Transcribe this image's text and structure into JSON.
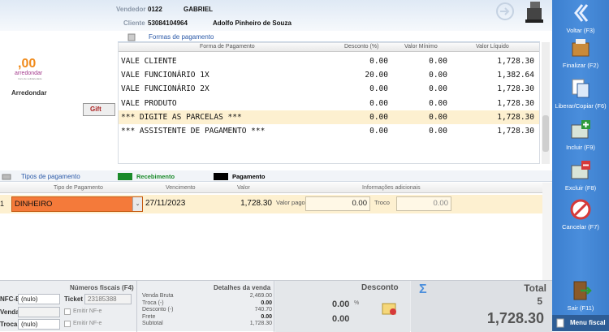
{
  "header": {
    "vendedor_label": "Vendedor",
    "vendedor_code": "0122",
    "vendedor_name": "GABRIEL",
    "cliente_label": "Cliente",
    "cliente_code": "53084104964",
    "cliente_name": "Adolfo Pinheiro de Souza"
  },
  "left": {
    "logo_text": ",00",
    "logo_sub": "arredondar",
    "logo_tiny": "troco de solidariedade",
    "arredondar_label": "Arredondar",
    "gift_label": "Gift"
  },
  "formas": {
    "title": "Formas de pagamento",
    "columns": [
      "Forma de Pagamento",
      "Desconto (%)",
      "Valor Mínimo",
      "Valor Líquido"
    ],
    "rows": [
      {
        "forma": "VALE CLIENTE",
        "desconto": "0.00",
        "minimo": "0.00",
        "liquido": "1,728.30"
      },
      {
        "forma": "VALE FUNCIONÁRIO 1X",
        "desconto": "20.00",
        "minimo": "0.00",
        "liquido": "1,382.64"
      },
      {
        "forma": "VALE FUNCIONÁRIO 2X",
        "desconto": "0.00",
        "minimo": "0.00",
        "liquido": "1,728.30"
      },
      {
        "forma": "VALE PRODUTO",
        "desconto": "0.00",
        "minimo": "0.00",
        "liquido": "1,728.30"
      },
      {
        "forma": "*** DIGITE AS PARCELAS ***",
        "desconto": "0.00",
        "minimo": "0.00",
        "liquido": "1,728.30"
      },
      {
        "forma": "*** ASSISTENTE DE PAGAMENTO ***",
        "desconto": "0.00",
        "minimo": "0.00",
        "liquido": "1,728.30"
      }
    ]
  },
  "tipos": {
    "title": "Tipos de pagamento",
    "recebimento": "Recebimento",
    "pagamento": "Pagamento",
    "colors": {
      "recebimento": "#1a8a2a",
      "pagamento": "#000000"
    }
  },
  "detail": {
    "columns": [
      "Tipo de Pagamento",
      "Vencimento",
      "Valor",
      "Informações adicionais"
    ],
    "row": {
      "index": "1",
      "tipo": "DINHEIRO",
      "vencimento": "27/11/2023",
      "valor": "1,728.30",
      "valor_pago_label": "Valor pago",
      "valor_pago": "0.00",
      "troco_label": "Troco",
      "troco": "0.00"
    }
  },
  "fiscal": {
    "title": "Números fiscais (F4)",
    "nfce_label": "NFC-E",
    "nfce_value": "(nulo)",
    "ticket_label": "Ticket",
    "ticket_value": "23185388",
    "venda_label": "Venda",
    "emitir1": "Emitir NF-e",
    "troca_label": "Troca",
    "troca_value": "(nulo)",
    "emitir2": "Emitir NF-e"
  },
  "detalhes": {
    "title": "Detalhes da venda",
    "rows": [
      {
        "label": "Venda Bruta",
        "value": "2,469.00"
      },
      {
        "label": "Troca (-)",
        "value": "0.00"
      },
      {
        "label": "Desconto (-)",
        "value": "740.70"
      },
      {
        "label": "Frete",
        "value": "0.00"
      },
      {
        "label": "Subtotal",
        "value": "1,728.30"
      }
    ]
  },
  "desconto": {
    "title": "Desconto",
    "pct": "0.00",
    "pct_sign": "%",
    "value": "0.00"
  },
  "total": {
    "title": "Total",
    "sigma": "Σ",
    "count": "5",
    "value": "1,728.30"
  },
  "sidebar": {
    "voltar": "Voltar (F3)",
    "finalizar": "Finalizar (F2)",
    "liberar": "Liberar/Copiar (F6)",
    "incluir": "Incluir (F9)",
    "excluir": "Excluir (F8)",
    "cancelar": "Cancelar (F7)",
    "sair": "Sair (F11)",
    "menu_fiscal": "Menu fiscal"
  }
}
